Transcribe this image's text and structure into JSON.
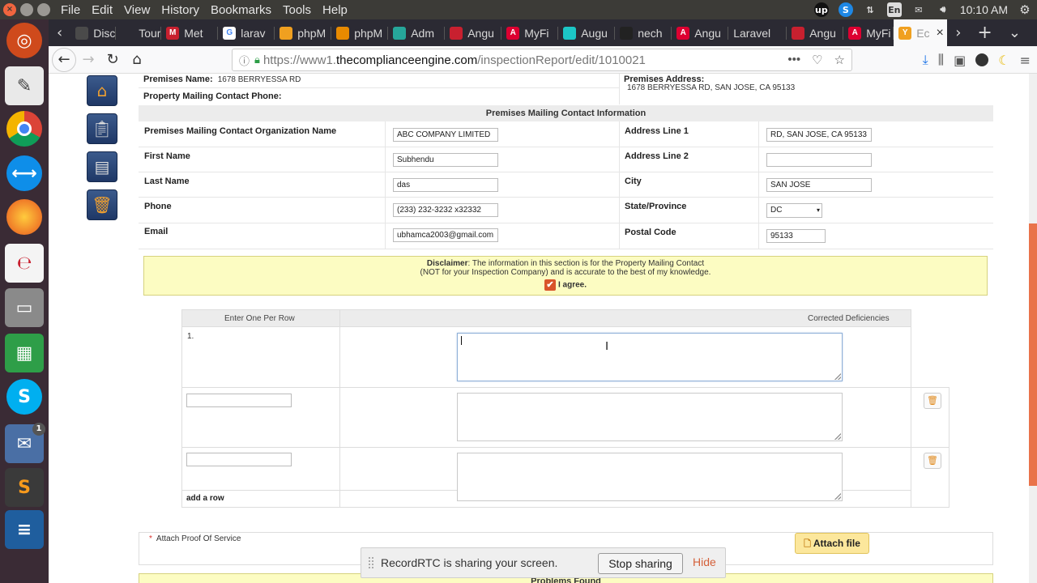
{
  "os": {
    "menu": [
      "File",
      "Edit",
      "View",
      "History",
      "Bookmarks",
      "Tools",
      "Help"
    ],
    "tray_language": "En",
    "clock": "10:10 AM"
  },
  "launcher": {
    "items": [
      "ubuntu-logo-icon",
      "text-editor-icon",
      "chrome-icon",
      "teamviewer-icon",
      "firefox-icon",
      "evince-icon",
      "files-icon",
      "spreadsheet-icon",
      "skype-icon",
      "mail-icon",
      "sublime-icon",
      "stack-icon"
    ],
    "mail_badge": "1"
  },
  "tabs": [
    {
      "label": "Disc",
      "fav": "#4a4a4a"
    },
    {
      "label": "Tour",
      "fav": "#2b2a33"
    },
    {
      "label": "Met",
      "fav": "#c8202f"
    },
    {
      "label": "larav",
      "fav": "#ffffff"
    },
    {
      "label": "phpM",
      "fav": "#f0a020"
    },
    {
      "label": "phpM",
      "fav": "#e88a00"
    },
    {
      "label": "Adm",
      "fav": "#26a69a"
    },
    {
      "label": "Angu",
      "fav": "#c8202f"
    },
    {
      "label": "MyFi",
      "fav": "#dd0031"
    },
    {
      "label": "Augu",
      "fav": "#1cc6c6"
    },
    {
      "label": "nech",
      "fav": "#222222"
    },
    {
      "label": "Angu",
      "fav": "#dd0031"
    },
    {
      "label": "Laravel",
      "fav": ""
    },
    {
      "label": "Angu",
      "fav": "#c8202f"
    },
    {
      "label": "MyFi",
      "fav": "#dd0031"
    },
    {
      "label": "Ec",
      "fav": "#f0a020"
    }
  ],
  "url": {
    "prefix": "https://www1.",
    "domain": "thecomplianceengine.com",
    "path": "/inspectionReport/edit/1010021"
  },
  "premises": {
    "name_label": "Premises Name:",
    "name_value": "1678 BERRYESSA RD",
    "phone_label": "Property Mailing Contact Phone:",
    "address_label": "Premises Address:",
    "address_value": "1678 BERRYESSA RD, SAN JOSE, CA 95133"
  },
  "contact": {
    "section_title": "Premises Mailing Contact Information",
    "org_label": "Premises Mailing Contact Organization Name",
    "org_value": "ABC COMPANY LIMITED",
    "first_label": "First Name",
    "first_value": "Subhendu",
    "last_label": "Last Name",
    "last_value": "das",
    "phone_label": "Phone",
    "phone_value": "(233) 232-3232 x32332",
    "email_label": "Email",
    "email_value": "ubhamca2003@gmail.com",
    "addr1_label": "Address Line 1",
    "addr1_value": "RD, SAN JOSE, CA 95133",
    "addr2_label": "Address Line 2",
    "addr2_value": "",
    "city_label": "City",
    "city_value": "SAN JOSE",
    "state_label": "State/Province",
    "state_value": "DC",
    "postal_label": "Postal Code",
    "postal_value": "95133"
  },
  "disclaimer": {
    "bold": "Disclaimer",
    "line1": ": The information in this section is for the Property Mailing Contact",
    "line2": "(NOT for your Inspection Company) and is accurate to the best of my knowledge.",
    "agree": "I agree."
  },
  "deficiencies": {
    "col1": "Enter One Per Row",
    "col2": "Corrected Deficiencies",
    "row1_num": "1.",
    "add_row": "add a row"
  },
  "attach": {
    "label": "Attach Proof Of Service",
    "required": "*",
    "button": "Attach file"
  },
  "problems_bar": "Problems Found",
  "share": {
    "message": "RecordRTC is sharing your screen.",
    "stop": "Stop sharing",
    "hide": "Hide"
  }
}
